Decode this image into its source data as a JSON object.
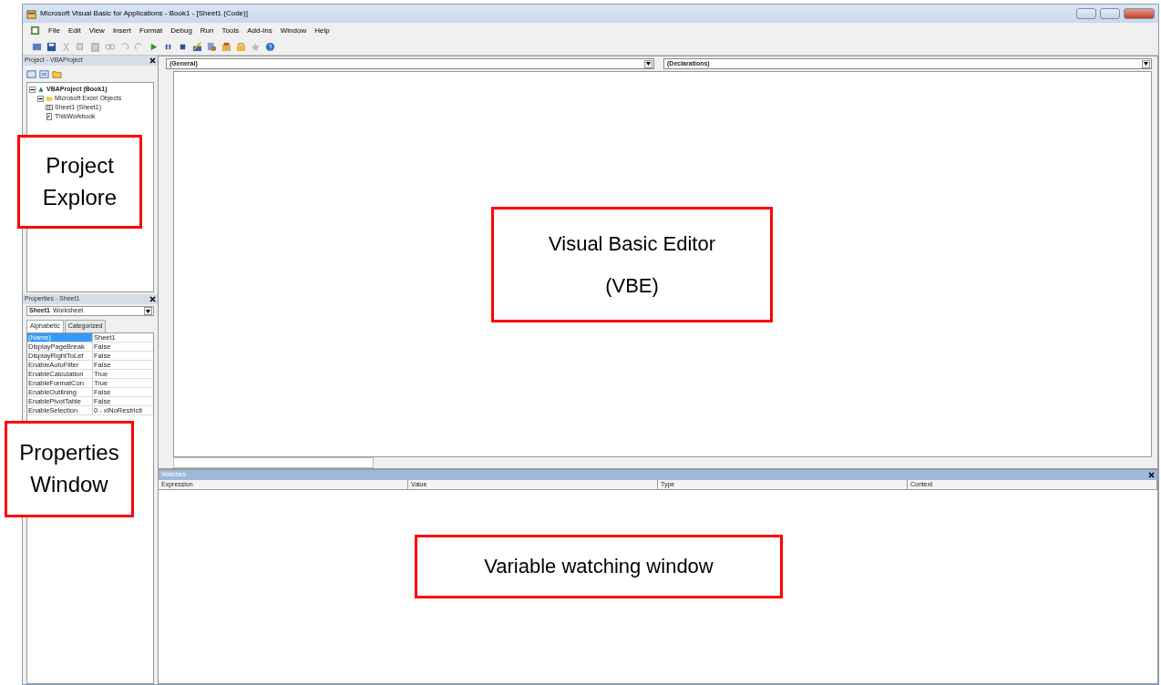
{
  "window": {
    "title": "Microsoft Visual Basic for Applications - Book1 - [Sheet1 (Code)]"
  },
  "menu": [
    "File",
    "Edit",
    "View",
    "Insert",
    "Format",
    "Debug",
    "Run",
    "Tools",
    "Add-Ins",
    "Window",
    "Help"
  ],
  "project": {
    "title": "Project - VBAProject",
    "tree": [
      {
        "label": "VBAProject (Book1)",
        "kind": "project",
        "expanded": true,
        "children": [
          {
            "label": "Microsoft Excel Objects",
            "kind": "folder",
            "expanded": true,
            "children": [
              {
                "label": "Sheet1 (Sheet1)",
                "kind": "sheet"
              },
              {
                "label": "ThisWorkbook",
                "kind": "workbook"
              }
            ]
          }
        ]
      }
    ]
  },
  "properties": {
    "title": "Properties - Sheet1",
    "object_name": "Sheet1",
    "object_type": "Worksheet",
    "tabs": [
      {
        "label": "Alphabetic",
        "selected": true
      },
      {
        "label": "Categorized",
        "selected": false
      }
    ],
    "rows": [
      {
        "name": "(Name)",
        "value": "Sheet1",
        "selected": true
      },
      {
        "name": "DisplayPageBreak",
        "value": "False",
        "selected": false
      },
      {
        "name": "DisplayRightToLef",
        "value": "False",
        "selected": false
      },
      {
        "name": "EnableAutoFilter",
        "value": "False",
        "selected": false
      },
      {
        "name": "EnableCalculation",
        "value": "True",
        "selected": false
      },
      {
        "name": "EnableFormatCon",
        "value": "True",
        "selected": false
      },
      {
        "name": "EnableOutlining",
        "value": "False",
        "selected": false
      },
      {
        "name": "EnablePivotTable",
        "value": "False",
        "selected": false
      },
      {
        "name": "EnableSelection",
        "value": "0 - xlNoRestricti",
        "selected": false
      }
    ]
  },
  "code": {
    "object": "(General)",
    "procedure": "(Declarations)"
  },
  "watches": {
    "title": "Watches",
    "columns": [
      "Expression",
      "Value",
      "Type",
      "Context"
    ]
  },
  "callouts": [
    {
      "lines": [
        "Project",
        "Explore"
      ]
    },
    {
      "lines": [
        "Visual Basic Editor",
        "(VBE)"
      ]
    },
    {
      "lines": [
        "Properties",
        "Window"
      ]
    },
    {
      "lines": [
        "Variable watching window"
      ]
    }
  ]
}
